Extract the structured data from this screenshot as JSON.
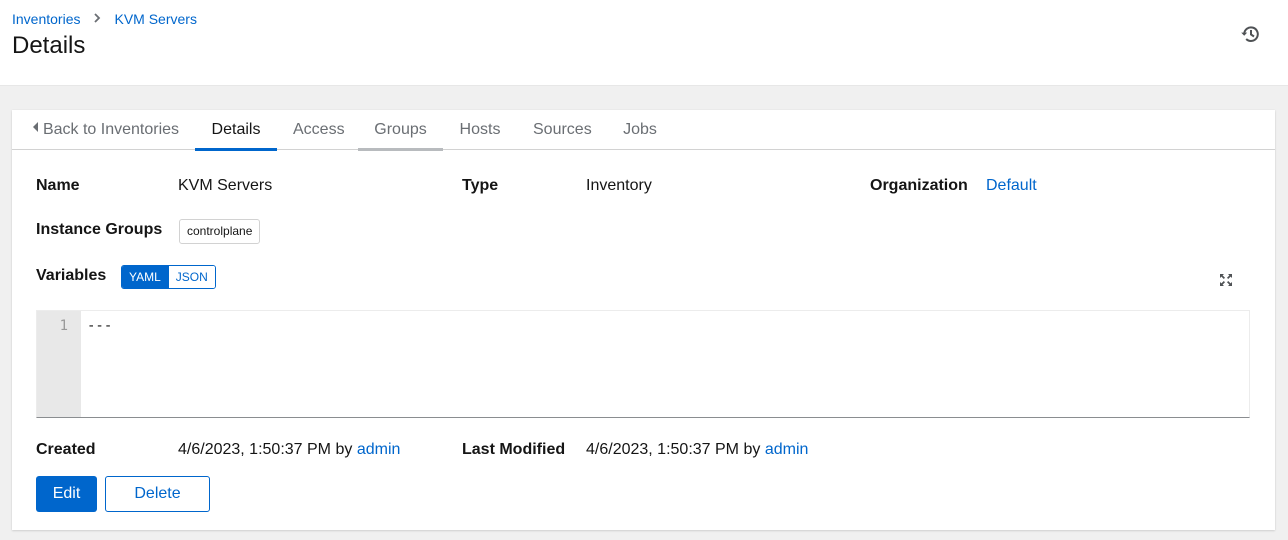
{
  "breadcrumb": [
    {
      "label": "Inventories"
    },
    {
      "label": "KVM Servers"
    }
  ],
  "page_title": "Details",
  "tabs": [
    {
      "label": "Back to Inventories"
    },
    {
      "label": "Details"
    },
    {
      "label": "Access"
    },
    {
      "label": "Groups"
    },
    {
      "label": "Hosts"
    },
    {
      "label": "Sources"
    },
    {
      "label": "Jobs"
    }
  ],
  "details": {
    "name": {
      "label": "Name",
      "value": "KVM Servers"
    },
    "type": {
      "label": "Type",
      "value": "Inventory"
    },
    "organization": {
      "label": "Organization",
      "value": "Default"
    },
    "instance_groups": {
      "label": "Instance Groups",
      "chips": [
        "controlplane"
      ]
    },
    "variables": {
      "label": "Variables",
      "modes": [
        "YAML",
        "JSON"
      ],
      "selected_mode": "YAML"
    },
    "editor": {
      "line_numbers": [
        "1"
      ],
      "lines": [
        "---"
      ]
    },
    "created": {
      "label": "Created",
      "date": "4/6/2023, 1:50:37 PM",
      "by": "by",
      "user": "admin"
    },
    "last_modified": {
      "label": "Last Modified",
      "date": "4/6/2023, 1:50:37 PM",
      "by": "by",
      "user": "admin"
    }
  },
  "actions": {
    "edit_label": "Edit",
    "delete_label": "Delete"
  },
  "icons": {
    "history": "history-icon",
    "expand": "expand-icon",
    "breadcrumb_separator": "chevron-right-icon",
    "back": "caret-left-icon"
  },
  "colors": {
    "link": "#0066cc",
    "primary": "#0066cc",
    "text": "#151515",
    "muted": "#6a6e73"
  }
}
